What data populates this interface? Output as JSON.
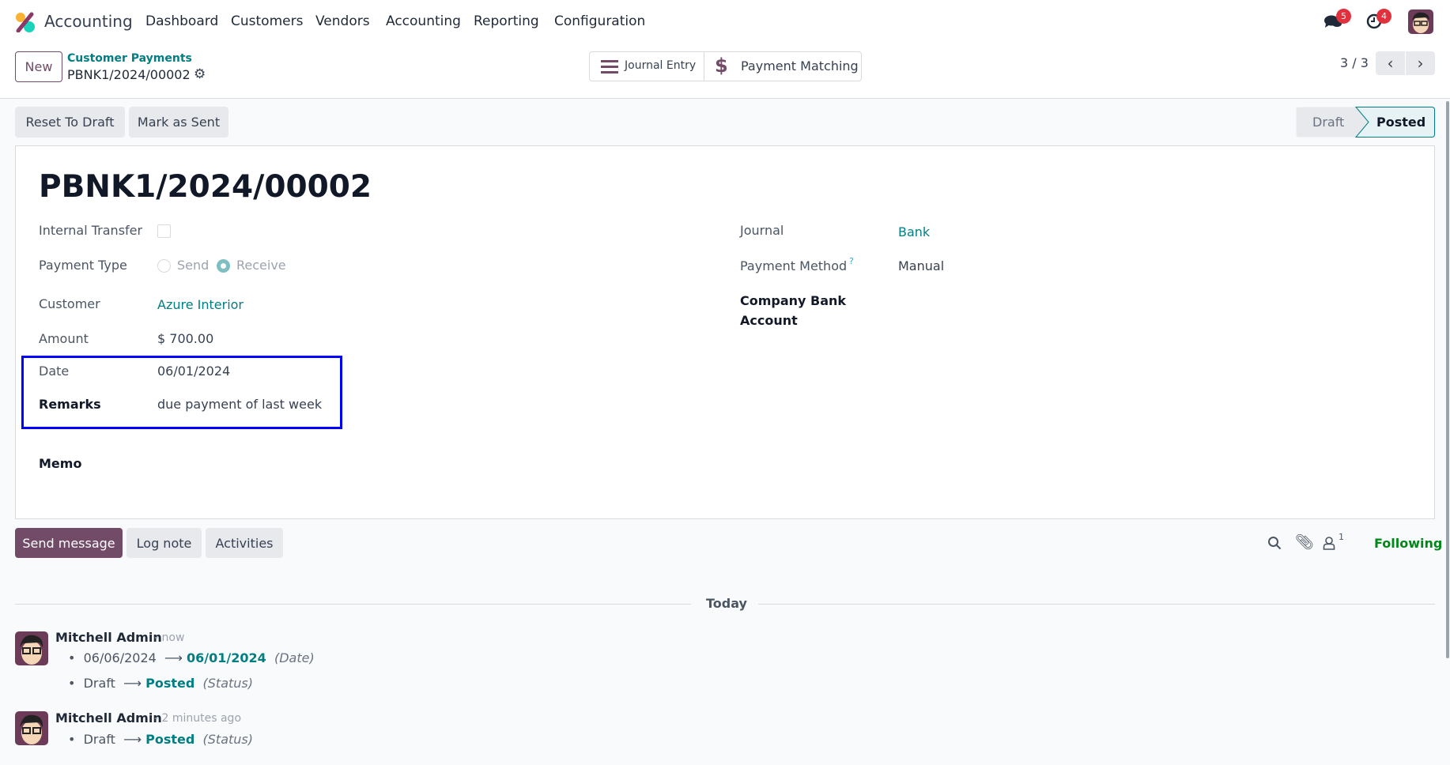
{
  "navbar": {
    "app": "Accounting",
    "menu": [
      "Dashboard",
      "Customers",
      "Vendors",
      "Accounting",
      "Reporting",
      "Configuration"
    ],
    "messages_count": "5",
    "activities_count": "4"
  },
  "control": {
    "new_label": "New",
    "breadcrumb": "Customer Payments",
    "record": "PBNK1/2024/00002",
    "journal_entry": "Journal Entry",
    "payment_matching": "Payment Matching",
    "pager": "3 / 3"
  },
  "statusbar": {
    "reset": "Reset To Draft",
    "mark_sent": "Mark as Sent",
    "stages": [
      "Draft",
      "Posted"
    ],
    "current": "Posted"
  },
  "form": {
    "title": "PBNK1/2024/00002",
    "left": {
      "internal_transfer": "Internal Transfer",
      "payment_type": "Payment Type",
      "send": "Send",
      "receive": "Receive",
      "customer_label": "Customer",
      "customer": "Azure Interior",
      "amount_label": "Amount",
      "amount": "$ 700.00",
      "date_label": "Date",
      "date": "06/01/2024",
      "remarks_label": "Remarks",
      "remarks": "due payment of last week",
      "memo_label": "Memo"
    },
    "right": {
      "journal_label": "Journal",
      "journal": "Bank",
      "method_label": "Payment Method",
      "method_help": "?",
      "method": "Manual",
      "bank_label": "Company Bank Account"
    }
  },
  "chatter": {
    "send": "Send message",
    "log": "Log note",
    "activities": "Activities",
    "followers": "1",
    "following": "Following",
    "today": "Today",
    "messages": [
      {
        "author": "Mitchell Admin",
        "time": "- now",
        "changes": [
          {
            "old": "06/06/2024",
            "new": "06/01/2024",
            "field": "(Date)"
          },
          {
            "old": "Draft",
            "new": "Posted",
            "field": "(Status)"
          }
        ]
      },
      {
        "author": "Mitchell Admin",
        "time": "- 2 minutes ago",
        "changes": [
          {
            "old": "Draft",
            "new": "Posted",
            "field": "(Status)"
          }
        ]
      }
    ]
  },
  "colors": {
    "brand": "#714b67",
    "teal": "#017e84",
    "highlight": "#0000ff",
    "following": "#008818"
  }
}
